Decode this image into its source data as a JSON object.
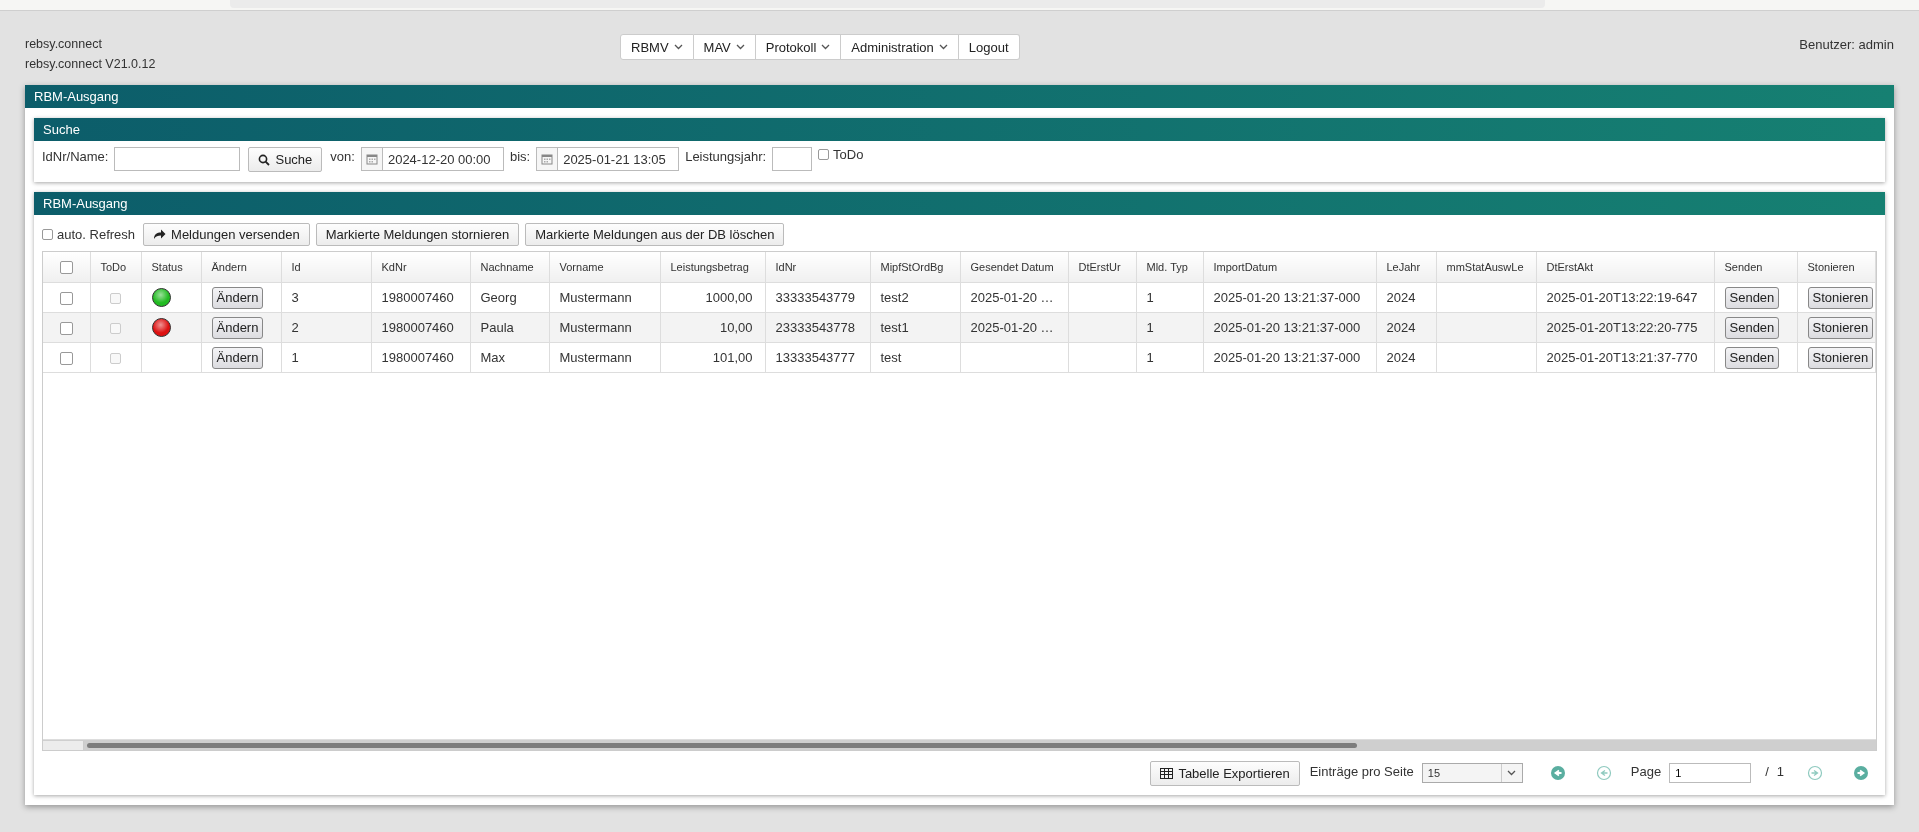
{
  "app": {
    "name": "rebsy.connect",
    "version": "rebsy.connect V21.0.12"
  },
  "nav": [
    {
      "label": "RBMV",
      "has_menu": true
    },
    {
      "label": "MAV",
      "has_menu": true
    },
    {
      "label": "Protokoll",
      "has_menu": true
    },
    {
      "label": "Administration",
      "has_menu": true
    },
    {
      "label": "Logout",
      "has_menu": false
    }
  ],
  "user": "Benutzer: admin",
  "panel_title": "RBM-Ausgang",
  "search": {
    "title": "Suche",
    "id_label": "IdNr/Name:",
    "search_button": "Suche",
    "from_label": "von:",
    "from_value": "2024-12-20 00:00",
    "to_label": "bis:",
    "to_value": "2025-01-21 13:05",
    "year_label": "Leistungsjahr:",
    "todo_label": "ToDo",
    "todo_checked": false
  },
  "list": {
    "title": "RBM-Ausgang",
    "auto_refresh_label": "auto. Refresh",
    "auto_refresh_checked": false,
    "buttons": [
      {
        "label": "Meldungen versenden",
        "kind": "send"
      },
      {
        "label": "Markierte Meldungen stornieren",
        "kind": "plain"
      },
      {
        "label": "Markierte Meldungen aus der DB löschen",
        "kind": "plain"
      }
    ]
  },
  "table": {
    "all_checked": false,
    "columns": [
      "ToDo",
      "Status",
      "Ändern",
      "Id",
      "KdNr",
      "Nachname",
      "Vorname",
      "Leistungsbetrag",
      "IdNr",
      "MipfStOrdBg",
      "Gesendet Datum",
      "DtErstUr",
      "Mld. Typ",
      "ImportDatum",
      "LeJahr",
      "mmStatAuswLe",
      "DtErstAkt",
      "Senden",
      "Stonieren"
    ],
    "rows": [
      {
        "checked": false,
        "todo": false,
        "color": "#22bb22",
        "edit": "Ändern",
        "id": "3",
        "kdnr": "1980007460",
        "nachname": "Georg",
        "vorname": "Mustermann",
        "betrag": "1000,00",
        "idnr": "33333543779",
        "mipf": "test2",
        "gesendet": "2025-01-20 …",
        "dterstur": "",
        "mldtyp": "1",
        "import": "2025-01-20 13:21:37-000",
        "lejahr": "2024",
        "mmstat": "",
        "dterstakt": "2025-01-20T13:22:19-647",
        "send": "Senden",
        "cancel": "Stonieren"
      },
      {
        "checked": false,
        "todo": false,
        "color": "#dd1111",
        "edit": "Ändern",
        "id": "2",
        "kdnr": "1980007460",
        "nachname": "Paula",
        "vorname": "Mustermann",
        "betrag": "10,00",
        "idnr": "23333543778",
        "mipf": "test1",
        "gesendet": "2025-01-20 …",
        "dterstur": "",
        "mldtyp": "1",
        "import": "2025-01-20 13:21:37-000",
        "lejahr": "2024",
        "mmstat": "",
        "dterstakt": "2025-01-20T13:22:20-775",
        "send": "Senden",
        "cancel": "Stonieren"
      },
      {
        "checked": false,
        "todo": false,
        "edit": "Ändern",
        "id": "1",
        "kdnr": "1980007460",
        "nachname": "Max",
        "vorname": "Mustermann",
        "betrag": "101,00",
        "idnr": "13333543777",
        "mipf": "test",
        "gesendet": "",
        "dterstur": "",
        "mldtyp": "1",
        "import": "2025-01-20 13:21:37-000",
        "lejahr": "2024",
        "mmstat": "",
        "dterstakt": "2025-01-20T13:21:37-770",
        "send": "Senden",
        "cancel": "Stonieren"
      }
    ]
  },
  "footer": {
    "export_button": "Tabelle Exportieren",
    "per_page_label": "Einträge pro Seite",
    "per_page_value": "15",
    "page_label": "Page",
    "page_value": "1",
    "page_sep": "/",
    "page_total": "1"
  }
}
